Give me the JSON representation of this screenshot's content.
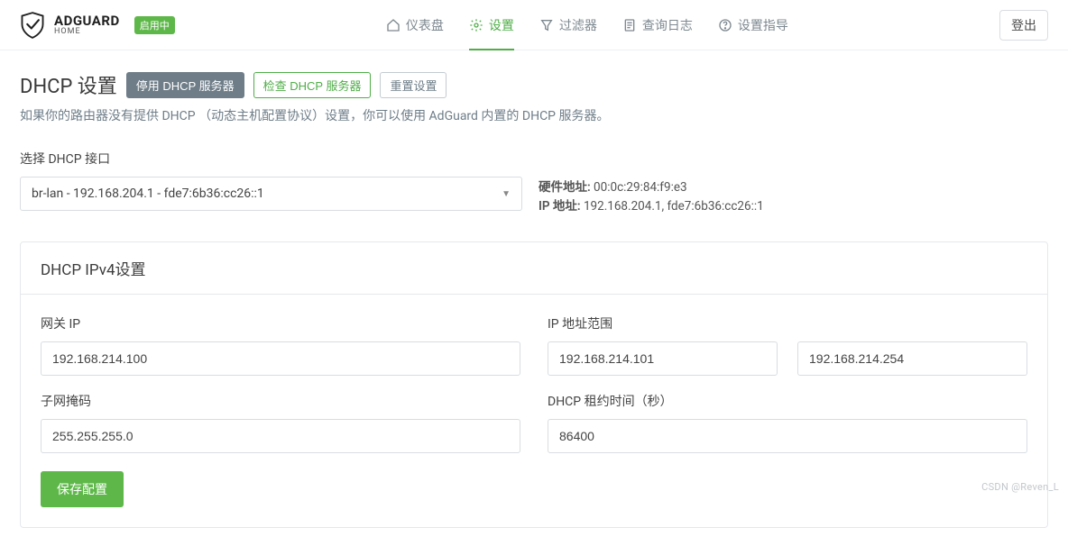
{
  "brand": {
    "name": "ADGUARD",
    "sub": "HOME",
    "status": "启用中"
  },
  "nav": {
    "dashboard": "仪表盘",
    "settings": "设置",
    "filters": "过滤器",
    "logs": "查询日志",
    "guide": "设置指导",
    "logout": "登出"
  },
  "page": {
    "title": "DHCP 设置",
    "disable_btn": "停用 DHCP 服务器",
    "check_btn": "检查 DHCP 服务器",
    "reset_btn": "重置设置",
    "subtitle": "如果你的路由器没有提供 DHCP （动态主机配置协议）设置，你可以使用 AdGuard 内置的 DHCP 服务器。"
  },
  "iface": {
    "label": "选择 DHCP 接口",
    "value": "br-lan - 192.168.204.1 - fde7:6b36:cc26::1",
    "hw_label": "硬件地址:",
    "hw_value": "00:0c:29:84:f9:e3",
    "ip_label": "IP 地址:",
    "ip_value": "192.168.204.1, fde7:6b36:cc26::1"
  },
  "card": {
    "title": "DHCP IPv4设置",
    "gateway_label": "网关 IP",
    "gateway_value": "192.168.214.100",
    "range_label": "IP 地址范围",
    "range_start": "192.168.214.101",
    "range_end": "192.168.214.254",
    "subnet_label": "子网掩码",
    "subnet_value": "255.255.255.0",
    "lease_label": "DHCP 租约时间（秒）",
    "lease_value": "86400",
    "save": "保存配置"
  },
  "watermark": "CSDN @Reven_L"
}
